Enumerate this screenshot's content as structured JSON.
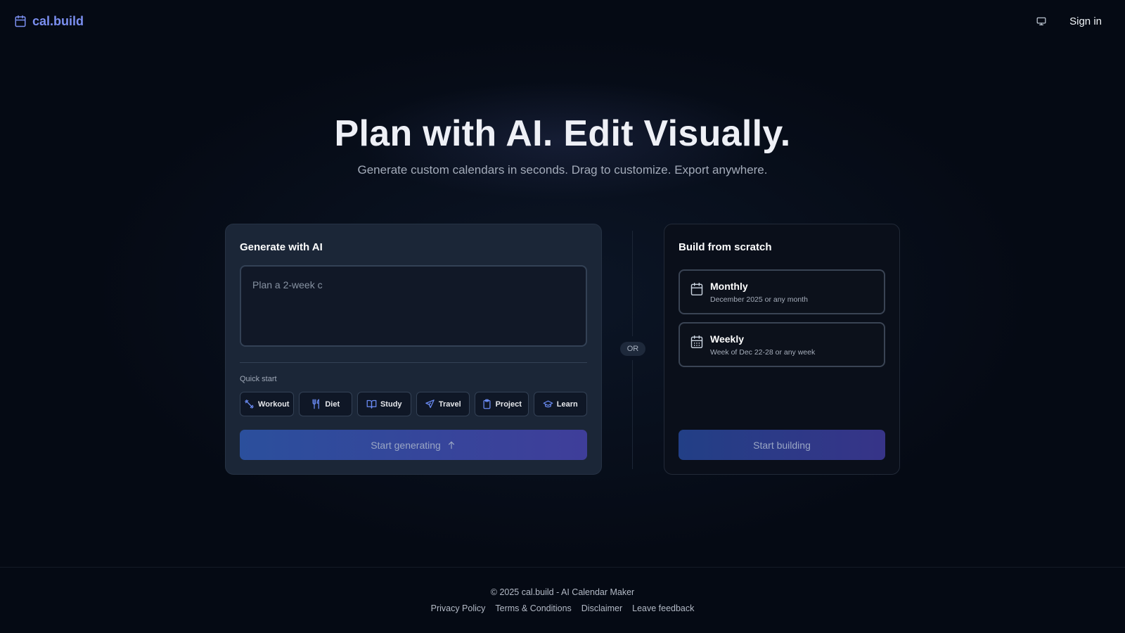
{
  "header": {
    "logo_text": "cal.build",
    "logo_icon": "calendar-icon",
    "display_icon": "monitor-icon",
    "signin_label": "Sign in"
  },
  "hero": {
    "title": "Plan with AI. Edit Visually.",
    "subtitle": "Generate custom calendars in seconds. Drag to customize. Export anywhere."
  },
  "ai_card": {
    "title": "Generate with AI",
    "prompt_placeholder": "Plan a 2-week c",
    "quick_start_label": "Quick start",
    "chips": [
      {
        "label": "Workout",
        "icon": "dumbbell-icon"
      },
      {
        "label": "Diet",
        "icon": "utensils-icon"
      },
      {
        "label": "Study",
        "icon": "book-icon"
      },
      {
        "label": "Travel",
        "icon": "plane-icon"
      },
      {
        "label": "Project",
        "icon": "clipboard-icon"
      },
      {
        "label": "Learn",
        "icon": "graduation-cap-icon"
      }
    ],
    "generate_label": "Start generating",
    "generate_icon": "arrow-up-icon"
  },
  "separator": {
    "label": "OR"
  },
  "build_card": {
    "title": "Build from scratch",
    "options": [
      {
        "title": "Monthly",
        "subtitle": "December 2025 or any month",
        "icon": "calendar-icon"
      },
      {
        "title": "Weekly",
        "subtitle": "Week of Dec 22-28 or any week",
        "icon": "calendar-grid-icon"
      }
    ],
    "build_label": "Start building"
  },
  "footer": {
    "copyright": "© 2025 cal.build - AI Calendar Maker",
    "links": [
      "Privacy Policy",
      "Terms & Conditions",
      "Disclaimer",
      "Leave feedback"
    ]
  },
  "colors": {
    "background": "#050a14",
    "accent": "#7b8ff0",
    "ai_card_bg": "#1b2637",
    "build_card_bg": "#0a0f1a"
  }
}
